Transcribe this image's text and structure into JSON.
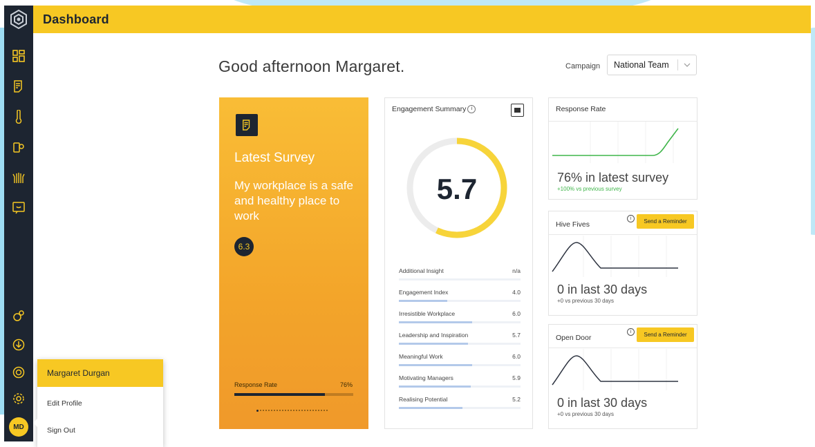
{
  "header": {
    "title": "Dashboard"
  },
  "greeting": "Good afternoon Margaret.",
  "campaign": {
    "label": "Campaign",
    "selected": "National Team"
  },
  "sidebar": {
    "icons": [
      "logo-icon",
      "dashboard-icon",
      "survey-icon",
      "thermometer-icon",
      "suggestion-icon",
      "hive-fives-icon",
      "feedback-icon",
      "integrations-icon",
      "download-icon",
      "help-icon",
      "settings-icon"
    ],
    "avatar_initials": "MD"
  },
  "latest_survey": {
    "heading": "Latest Survey",
    "question": "My workplace is a safe and healthy place to work",
    "score": "6.3",
    "response_rate_label": "Response Rate",
    "response_rate_value": "76%",
    "response_rate": 0.76
  },
  "engagement": {
    "title": "Engagement Summary",
    "score": "5.7",
    "score_fraction": 0.57,
    "metrics": [
      {
        "label": "Additional Insight",
        "value": "n/a",
        "fill": 0.0
      },
      {
        "label": "Engagement Index",
        "value": "4.0",
        "fill": 0.4
      },
      {
        "label": "Irresistible Workplace",
        "value": "6.0",
        "fill": 0.6
      },
      {
        "label": "Leadership and Inspiration",
        "value": "5.7",
        "fill": 0.57
      },
      {
        "label": "Meaningful Work",
        "value": "6.0",
        "fill": 0.6
      },
      {
        "label": "Motivating Managers",
        "value": "5.9",
        "fill": 0.59
      },
      {
        "label": "Realising Potential",
        "value": "5.2",
        "fill": 0.52
      }
    ]
  },
  "response_rate_card": {
    "title": "Response Rate",
    "headline": "76% in latest survey",
    "sub": "+100% vs previous survey",
    "line_color": "#3fb54a"
  },
  "hive_fives": {
    "title": "Hive Fives",
    "button": "Send a Reminder",
    "headline": "0 in last 30 days",
    "sub": "+0 vs previous 30 days"
  },
  "open_door": {
    "title": "Open Door",
    "button": "Send a Reminder",
    "headline": "0 in last 30 days",
    "sub": "+0 vs previous 30 days"
  },
  "user_menu": {
    "name": "Margaret Durgan",
    "edit_profile": "Edit Profile",
    "sign_out": "Sign Out"
  },
  "colors": {
    "accent": "#f7c823",
    "sidebar": "#1d2531",
    "bar_fill": "#b3c9ea"
  }
}
